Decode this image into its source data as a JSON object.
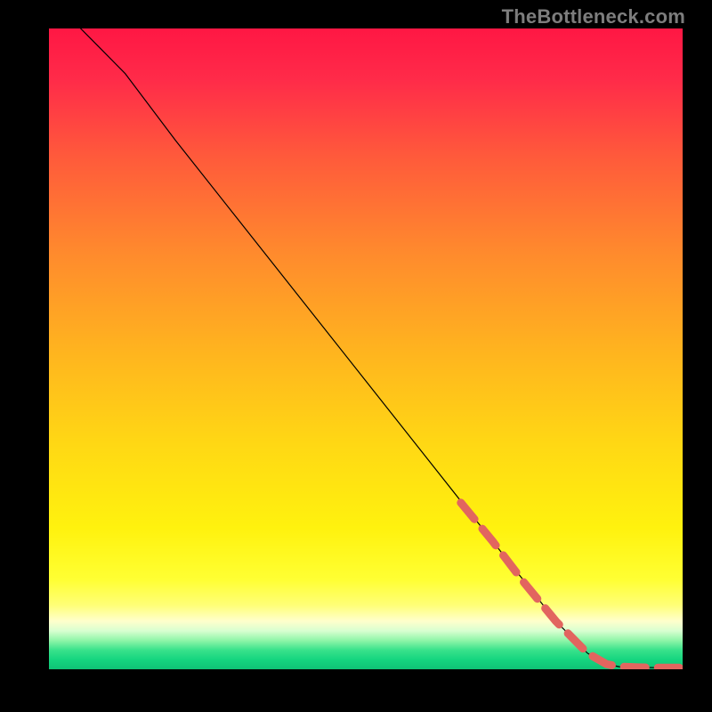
{
  "watermark": "TheBottleneck.com",
  "chart_data": {
    "type": "line",
    "title": "",
    "xlabel": "",
    "ylabel": "",
    "xlim": [
      0,
      100
    ],
    "ylim": [
      0,
      100
    ],
    "grid": false,
    "legend": false,
    "series": [
      {
        "name": "curve",
        "color": "#000000",
        "stroke_width": 1.2,
        "x": [
          5,
          8,
          12,
          20,
          30,
          40,
          50,
          60,
          70,
          80,
          85,
          88,
          90,
          93,
          96,
          100
        ],
        "y": [
          100,
          97,
          93,
          82.5,
          70,
          57.5,
          45,
          32.5,
          20,
          7.5,
          2.5,
          0.8,
          0.4,
          0.3,
          0.25,
          0.25
        ]
      },
      {
        "name": "dash-overlay",
        "color": "#e2655f",
        "stroke_width": 9,
        "dashed": true,
        "x": [
          65,
          70,
          75,
          80,
          85,
          88,
          90,
          93,
          96,
          100
        ],
        "y": [
          26,
          20,
          13.5,
          7.5,
          2.5,
          0.8,
          0.4,
          0.3,
          0.25,
          0.25
        ]
      }
    ],
    "background_gradient": {
      "type": "vertical",
      "stops": [
        {
          "offset": 0.0,
          "color": "#ff1744"
        },
        {
          "offset": 0.08,
          "color": "#ff2b49"
        },
        {
          "offset": 0.2,
          "color": "#ff5a3b"
        },
        {
          "offset": 0.35,
          "color": "#ff8a2d"
        },
        {
          "offset": 0.5,
          "color": "#ffb31f"
        },
        {
          "offset": 0.65,
          "color": "#ffd814"
        },
        {
          "offset": 0.78,
          "color": "#fff20e"
        },
        {
          "offset": 0.86,
          "color": "#ffff33"
        },
        {
          "offset": 0.9,
          "color": "#ffff77"
        },
        {
          "offset": 0.925,
          "color": "#ffffcc"
        },
        {
          "offset": 0.94,
          "color": "#d8ffd0"
        },
        {
          "offset": 0.955,
          "color": "#8ff5a8"
        },
        {
          "offset": 0.97,
          "color": "#39e28b"
        },
        {
          "offset": 0.985,
          "color": "#15d57f"
        },
        {
          "offset": 1.0,
          "color": "#0fc275"
        }
      ]
    }
  }
}
